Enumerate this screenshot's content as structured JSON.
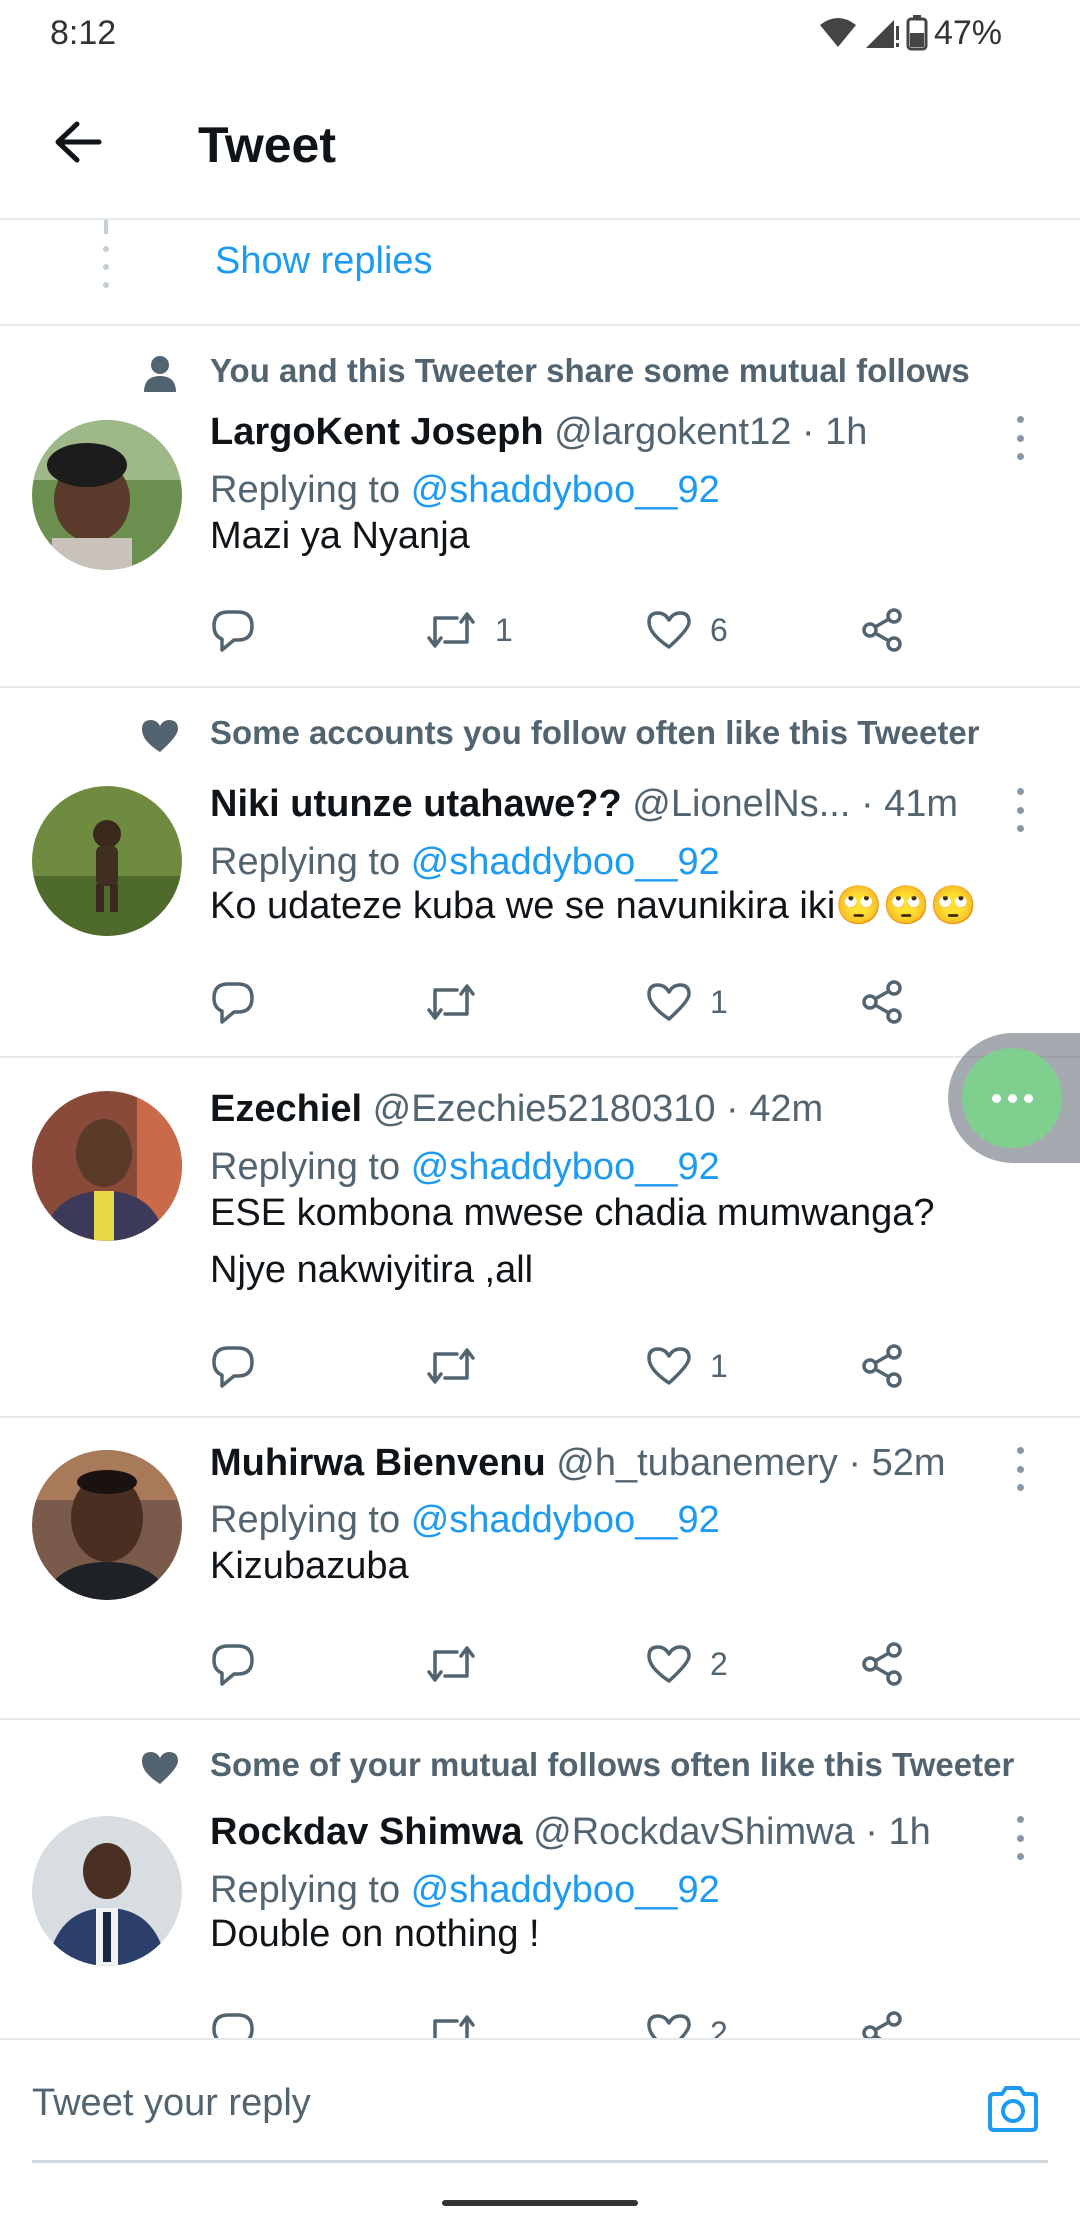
{
  "status_bar": {
    "time": "8:12",
    "battery": "47%",
    "icons": [
      "wifi-icon",
      "signal-icon",
      "battery-icon"
    ]
  },
  "header": {
    "title": "Tweet",
    "back_icon": "arrow-left-icon"
  },
  "thread": {
    "show_replies_label": "Show replies"
  },
  "colors": {
    "accent": "#1d9bf0",
    "secondary_text": "#536471",
    "fab": "#7fcf8f"
  },
  "tweets": [
    {
      "context": "You and this Tweeter share some mutual follows",
      "context_icon": "person-icon",
      "name": "LargoKent Joseph",
      "handle": "@largokent12",
      "time": "· 1h",
      "replying_prefix": "Replying to",
      "replying_to": "@shaddyboo__92",
      "text": "Mazi ya Nyanja",
      "retweets": "1",
      "likes": "6"
    },
    {
      "context": "Some accounts you follow often like this Tweeter",
      "context_icon": "heart-icon",
      "name": "Niki utunze utahawe??",
      "handle": "@LionelNs...",
      "time": "· 41m",
      "replying_prefix": "Replying to",
      "replying_to": "@shaddyboo__92",
      "text": "Ko udateze kuba we se navunikira iki🙄🙄🙄",
      "retweets": "",
      "likes": "1"
    },
    {
      "context": "",
      "name": "Ezechiel",
      "handle": "@Ezechie52180310",
      "time": "· 42m",
      "replying_prefix": "Replying to",
      "replying_to": "@shaddyboo__92",
      "text_line1": "ESE kombona mwese chadia mumwanga?",
      "text_line2": "Njye nakwiyitira ,all",
      "retweets": "",
      "likes": "1"
    },
    {
      "context": "",
      "name": "Muhirwa Bienvenu",
      "handle": "@h_tubanemery",
      "time": "· 52m",
      "replying_prefix": "Replying to",
      "replying_to": "@shaddyboo__92",
      "text": "Kizubazuba",
      "retweets": "",
      "likes": "2"
    },
    {
      "context": "Some of your mutual follows often like this Tweeter",
      "context_icon": "heart-icon",
      "name": "Rockdav Shimwa",
      "handle": "@RockdavShimwa",
      "time": "· 1h",
      "replying_prefix": "Replying to",
      "replying_to": "@shaddyboo__92",
      "text": "Double on nothing !",
      "retweets": "",
      "likes": "2"
    }
  ],
  "reply_bar": {
    "placeholder": "Tweet your reply",
    "camera_icon": "camera-icon"
  }
}
